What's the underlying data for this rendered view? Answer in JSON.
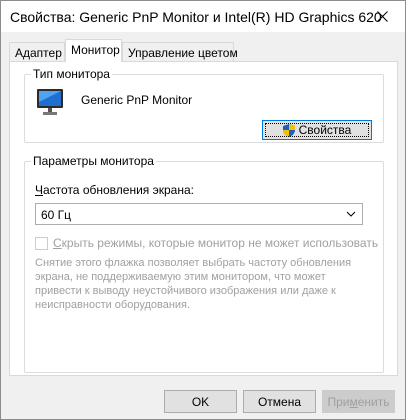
{
  "window": {
    "title": "Свойства: Generic PnP Monitor и Intel(R) HD Graphics 620"
  },
  "tabs": [
    {
      "label": "Адаптер",
      "active": false
    },
    {
      "label": "Монитор",
      "active": true
    },
    {
      "label": "Управление цветом",
      "active": false
    }
  ],
  "monitor_type": {
    "legend": "Тип монитора",
    "name": "Generic PnP Monitor",
    "properties_button": "Свойства"
  },
  "monitor_params": {
    "legend": "Параметры монитора",
    "refresh_label_underlined": "Ч",
    "refresh_label_rest": "астота обновления экрана:",
    "refresh_value": "60 Гц",
    "hide_modes_checked": false,
    "hide_modes_label_underlined": "С",
    "hide_modes_label_rest": "крыть режимы, которые монитор не может использовать",
    "help_text": "Снятие этого флажка позволяет выбрать частоту обновления экрана, не поддерживаемую этим монитором, что может привести к выводу неустойчивого изображения или даже к неисправности оборудования."
  },
  "footer": {
    "ok": "OK",
    "cancel": "Отмена",
    "apply_pre": "При",
    "apply_underlined": "м",
    "apply_post": "енить"
  }
}
